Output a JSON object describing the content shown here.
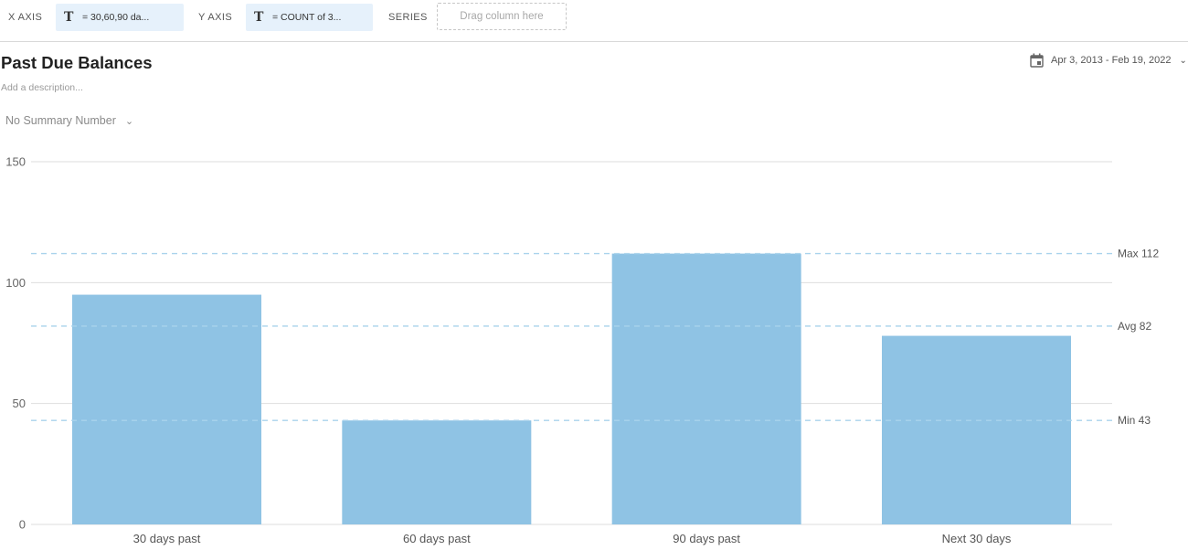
{
  "toolbar": {
    "x_axis_label": "X AXIS",
    "x_axis_value": "= 30,60,90 da...",
    "y_axis_label": "Y AXIS",
    "y_axis_value": "= COUNT of 3...",
    "series_label": "SERIES",
    "series_placeholder": "Drag column here",
    "field_icon": "text-type-icon"
  },
  "header": {
    "title": "Past Due Balances",
    "description_placeholder": "Add a description...",
    "summary_label": "No Summary Number",
    "date_range": "Apr 3, 2013 - Feb 19, 2022"
  },
  "colors": {
    "bar": "#8fc3e4",
    "reference_line": "#a9d3ec",
    "grid": "#dedede",
    "pill_bg": "#e6f1fb"
  },
  "chart_data": {
    "type": "bar",
    "categories": [
      "30 days past",
      "60 days past",
      "90 days past",
      "Next 30 days"
    ],
    "values": [
      95,
      43,
      112,
      78
    ],
    "ylim": [
      0,
      150
    ],
    "yticks": [
      0,
      50,
      100,
      150
    ],
    "grid": true,
    "reference_lines": [
      {
        "label": "Max 112",
        "value": 112
      },
      {
        "label": "Avg 82",
        "value": 82
      },
      {
        "label": "Min 43",
        "value": 43
      }
    ]
  }
}
